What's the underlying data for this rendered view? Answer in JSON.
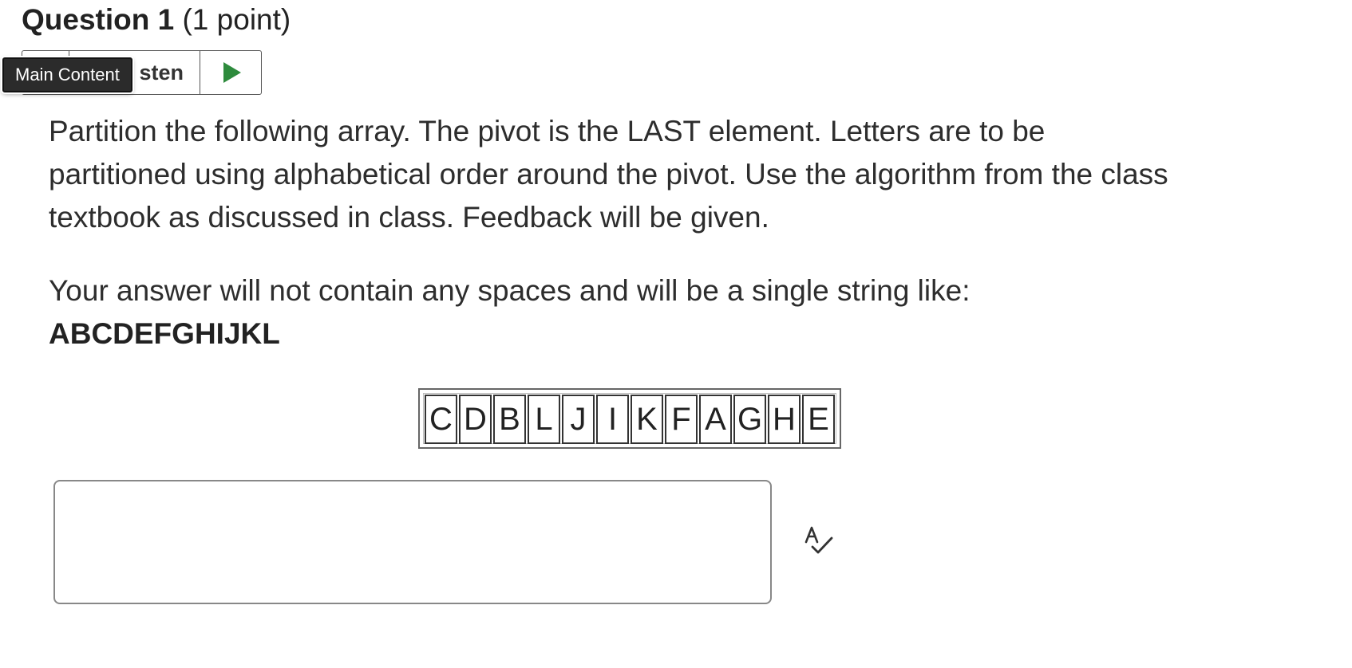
{
  "question": {
    "title": "Question 1",
    "points": " (1 point)"
  },
  "listen": {
    "label": "sten",
    "play_icon": "play-icon",
    "play_color": "#2e8b3d"
  },
  "tooltip": {
    "label": "Main Content"
  },
  "prompt": {
    "paragraph1": "Partition the following array. The pivot is the LAST element. Letters are to be partitioned using alphabetical order around the pivot. Use the algorithm from the class textbook as discussed in class. Feedback will be given.",
    "paragraph2": "Your answer will not contain any spaces and will be a single string like:",
    "example": "ABCDEFGHIJKL"
  },
  "array": {
    "cells": [
      "C",
      "D",
      "B",
      "L",
      "J",
      "I",
      "K",
      "F",
      "A",
      "G",
      "H",
      "E"
    ]
  },
  "answer": {
    "value": "",
    "placeholder": ""
  },
  "spellcheck_icon": "spellcheck-icon"
}
